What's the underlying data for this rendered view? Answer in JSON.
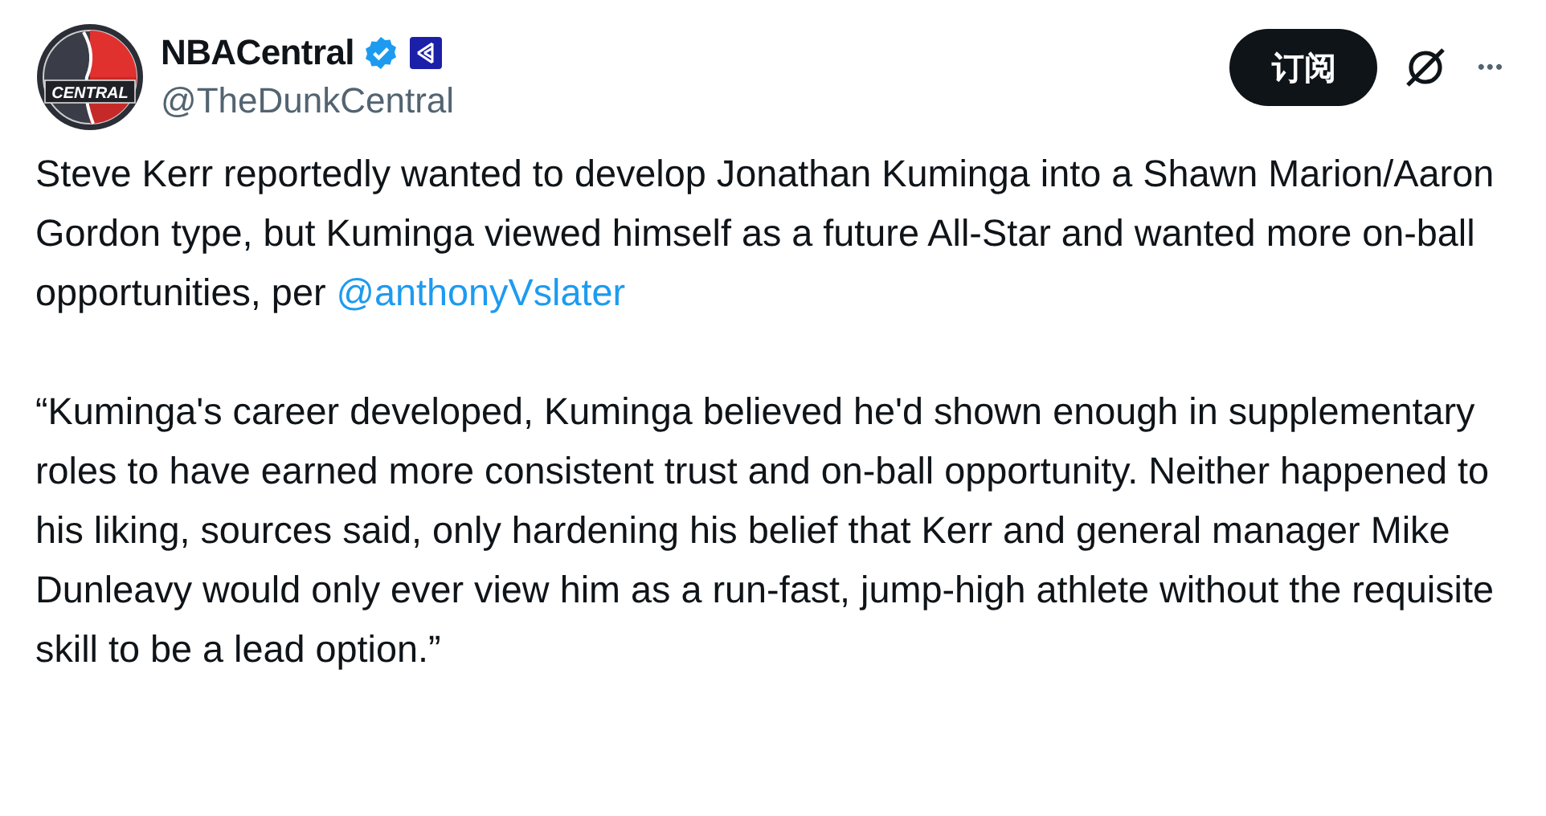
{
  "author": {
    "avatar_label": "CENTRAL",
    "name": "NBACentral",
    "verified": true,
    "handle": "@TheDunkCentral"
  },
  "actions": {
    "subscribe": "订阅",
    "more": "•••"
  },
  "post": {
    "paragraphs": [
      {
        "parts": [
          {
            "kind": "text",
            "text": "Steve Kerr reportedly wanted to develop Jonathan Kuminga into a Shawn Marion/Aaron Gordon type, but Kuminga viewed himself as a future All-Star and wanted more on-ball opportunities, per "
          },
          {
            "kind": "mention",
            "text": "@anthonyVslater"
          }
        ]
      },
      {
        "parts": [
          {
            "kind": "text",
            "text": "“Kuminga's career developed, Kuminga believed he'd shown enough in supplementary roles to have earned more consistent trust and on-ball opportunity. Neither happened to his liking, sources said, only hardening his belief that Kerr and general manager Mike Dunleavy would only ever view him as a run-fast, jump-high athlete without the requisite skill to be a lead option.”"
          }
        ]
      }
    ]
  }
}
